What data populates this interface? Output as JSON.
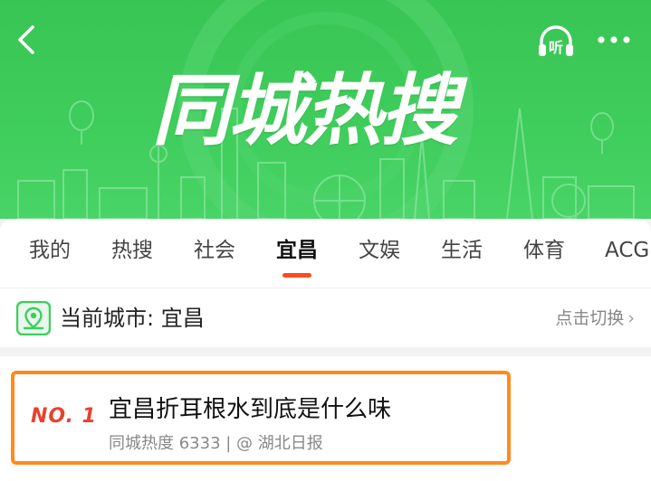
{
  "header": {
    "title": "同城热搜",
    "back_icon": "back-arrow-icon",
    "listen_icon": "headphones-listen-icon",
    "listen_label": "听",
    "more_icon": "more-dots-icon",
    "theme_color": "#3fcd5c"
  },
  "tabs": {
    "items": [
      {
        "label": "我的"
      },
      {
        "label": "热搜"
      },
      {
        "label": "社会"
      },
      {
        "label": "宜昌"
      },
      {
        "label": "文娱"
      },
      {
        "label": "生活"
      },
      {
        "label": "体育"
      },
      {
        "label": "ACG"
      }
    ],
    "active": "宜昌",
    "active_color": "#ff4b1f"
  },
  "city_bar": {
    "icon": "map-location-icon",
    "label": "当前城市: 宜昌",
    "switch_label": "点击切换"
  },
  "list": {
    "items": [
      {
        "rank": "NO. 1",
        "title": "宜昌折耳根水到底是什么味",
        "meta": "同城热度 6333 | @ 湖北日报"
      }
    ],
    "highlight_color": "#ff8a1e",
    "rank_color": "#e8422f"
  }
}
